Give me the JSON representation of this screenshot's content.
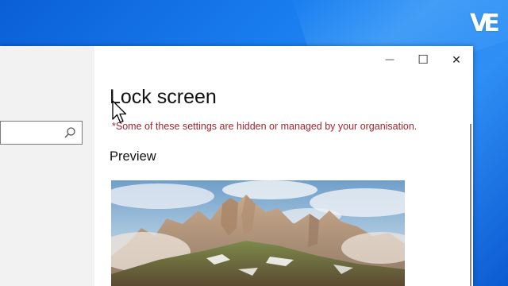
{
  "desktop": {
    "logo_text": "VE"
  },
  "window": {
    "controls": {
      "minimize_glyph": "—",
      "maximize_glyph": "☐",
      "close_glyph": "✕"
    },
    "nav": {
      "search": {
        "value": "",
        "placeholder": "",
        "icon": "search-icon"
      }
    },
    "content": {
      "title": "Lock screen",
      "managed_note": "*Some of these settings are hidden or managed by your organisation.",
      "preview_heading": "Preview"
    }
  },
  "colors": {
    "desktop_blue": "#1a7ef0",
    "warning_text": "#a4262c",
    "nav_background": "#f2f2f2"
  }
}
